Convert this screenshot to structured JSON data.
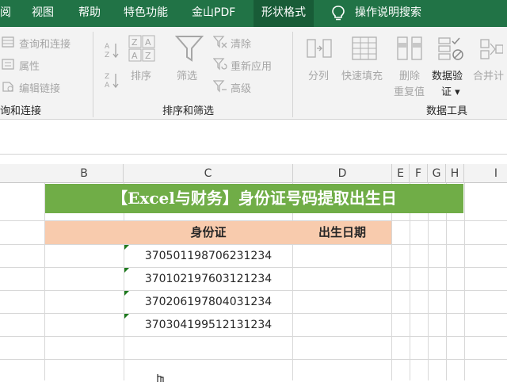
{
  "ribbon_tabs": [
    {
      "label": "阅"
    },
    {
      "label": "视图"
    },
    {
      "label": "帮助"
    },
    {
      "label": "特色功能"
    },
    {
      "label": "金山PDF"
    },
    {
      "label": "形状格式",
      "active": true
    }
  ],
  "tell_me": "操作说明搜索",
  "groups": {
    "queries": {
      "items": [
        "查询和连接",
        "属性",
        "编辑链接"
      ],
      "label": "询和连接"
    },
    "sort_filter": {
      "sort": "排序",
      "filter": "筛选",
      "clear": "清除",
      "reapply": "重新应用",
      "advanced": "高级",
      "label": "排序和筛选"
    },
    "data_tools": {
      "split": "分列",
      "flash_fill": "快速填充",
      "remove_dup_1": "删除",
      "remove_dup_2": "重复值",
      "validation_1": "数据验",
      "validation_2": "证 ▾",
      "consolidate": "合并计",
      "label": "数据工具"
    }
  },
  "columns": [
    "B",
    "C",
    "D",
    "E",
    "F",
    "G",
    "H",
    "I"
  ],
  "sheet": {
    "title": "【Excel与财务】身份证号码提取出生日",
    "header_id": "身份证",
    "header_birth": "出生日期",
    "ids": [
      "370501198706231234",
      "370102197603121234",
      "370206197804031234",
      "370304199512131234"
    ]
  },
  "colors": {
    "ribbon": "#217346",
    "title_fill": "#70ad47",
    "header_fill": "#f8cbad"
  }
}
